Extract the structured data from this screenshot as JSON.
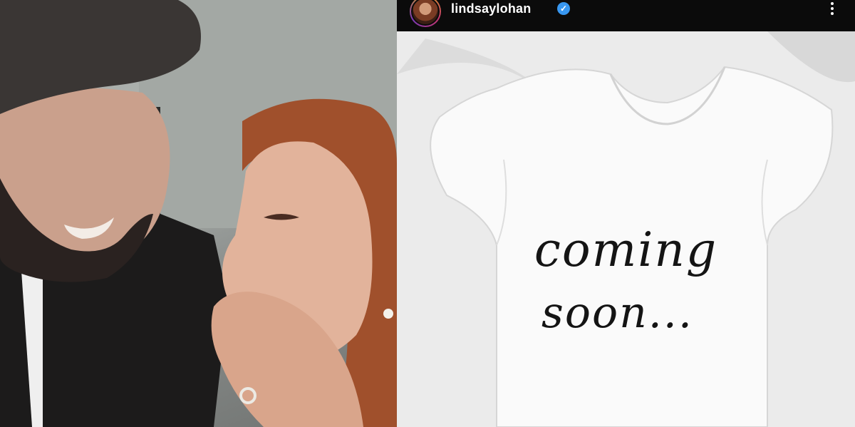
{
  "post": {
    "username": "lindsaylohan",
    "verified": true,
    "onesie_text_line1": "coming",
    "onesie_text_line2": "soon..."
  },
  "icons": {
    "avatar": "profile-avatar",
    "verified": "verified-badge-icon",
    "more": "more-options-icon"
  },
  "colors": {
    "header_bg": "#0b0b0b",
    "verified_blue": "#3897f0",
    "onesie_white": "#f4f4f4"
  }
}
